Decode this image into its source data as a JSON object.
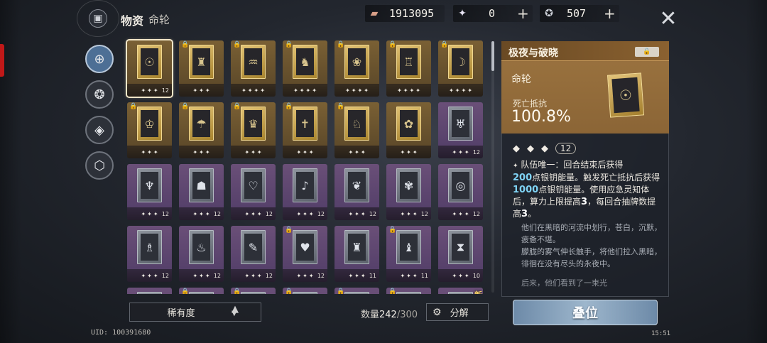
{
  "header": {
    "title": "物资",
    "subtitle": "命轮",
    "resources": [
      {
        "icon": "ticket-icon",
        "value": "1913095",
        "has_plus": false
      },
      {
        "icon": "crystal-icon",
        "value": "0",
        "has_plus": true
      },
      {
        "icon": "orb-icon",
        "value": "507",
        "has_plus": true
      }
    ]
  },
  "sidebar": {
    "items": [
      {
        "name": "compass-tab",
        "glyph": "⊕",
        "active": true
      },
      {
        "name": "prism-tab",
        "glyph": "❂",
        "active": false
      },
      {
        "name": "diamond-tab",
        "glyph": "◈",
        "active": false
      },
      {
        "name": "cube-tab",
        "glyph": "⬡",
        "active": false
      }
    ]
  },
  "grid": {
    "rows": [
      [
        {
          "rarity": "gold",
          "stars": 3,
          "level": "12",
          "locked": false,
          "selected": true,
          "art": "☉"
        },
        {
          "rarity": "gold",
          "stars": 3,
          "level": "",
          "locked": true,
          "selected": false,
          "art": "♜"
        },
        {
          "rarity": "gold",
          "stars": 4,
          "level": "",
          "locked": true,
          "selected": false,
          "art": "♒"
        },
        {
          "rarity": "gold",
          "stars": 4,
          "level": "",
          "locked": true,
          "selected": false,
          "art": "♞"
        },
        {
          "rarity": "gold",
          "stars": 4,
          "level": "",
          "locked": true,
          "selected": false,
          "art": "❀"
        },
        {
          "rarity": "gold",
          "stars": 4,
          "level": "",
          "locked": true,
          "selected": false,
          "art": "♖"
        },
        {
          "rarity": "gold",
          "stars": 4,
          "level": "",
          "locked": true,
          "selected": false,
          "art": "☽"
        }
      ],
      [
        {
          "rarity": "gold",
          "stars": 3,
          "level": "",
          "locked": true,
          "selected": false,
          "art": "♔"
        },
        {
          "rarity": "gold",
          "stars": 3,
          "level": "",
          "locked": true,
          "selected": false,
          "art": "☂"
        },
        {
          "rarity": "gold",
          "stars": 3,
          "level": "",
          "locked": true,
          "selected": false,
          "art": "♛"
        },
        {
          "rarity": "gold",
          "stars": 3,
          "level": "",
          "locked": true,
          "selected": false,
          "art": "✝"
        },
        {
          "rarity": "gold",
          "stars": 3,
          "level": "",
          "locked": true,
          "selected": false,
          "art": "♘"
        },
        {
          "rarity": "gold",
          "stars": 3,
          "level": "",
          "locked": false,
          "selected": false,
          "art": "✿"
        },
        {
          "rarity": "purple",
          "stars": 3,
          "level": "12",
          "locked": false,
          "selected": false,
          "art": "♅"
        }
      ],
      [
        {
          "rarity": "purple",
          "stars": 3,
          "level": "12",
          "locked": false,
          "selected": false,
          "art": "♆"
        },
        {
          "rarity": "purple",
          "stars": 3,
          "level": "12",
          "locked": false,
          "selected": false,
          "art": "☗"
        },
        {
          "rarity": "purple",
          "stars": 3,
          "level": "12",
          "locked": false,
          "selected": false,
          "art": "♡"
        },
        {
          "rarity": "purple",
          "stars": 3,
          "level": "12",
          "locked": false,
          "selected": false,
          "art": "♪"
        },
        {
          "rarity": "purple",
          "stars": 3,
          "level": "12",
          "locked": false,
          "selected": false,
          "art": "❦"
        },
        {
          "rarity": "purple",
          "stars": 3,
          "level": "12",
          "locked": false,
          "selected": false,
          "art": "✾"
        },
        {
          "rarity": "purple",
          "stars": 3,
          "level": "12",
          "locked": false,
          "selected": false,
          "art": "◎"
        }
      ],
      [
        {
          "rarity": "purple",
          "stars": 3,
          "level": "12",
          "locked": false,
          "selected": false,
          "art": "♗"
        },
        {
          "rarity": "purple",
          "stars": 3,
          "level": "12",
          "locked": false,
          "selected": false,
          "art": "♨"
        },
        {
          "rarity": "purple",
          "stars": 3,
          "level": "12",
          "locked": false,
          "selected": false,
          "art": "✎"
        },
        {
          "rarity": "purple",
          "stars": 3,
          "level": "12",
          "locked": true,
          "selected": false,
          "art": "♥"
        },
        {
          "rarity": "purple",
          "stars": 3,
          "level": "11",
          "locked": false,
          "selected": false,
          "art": "♜"
        },
        {
          "rarity": "purple",
          "stars": 3,
          "level": "11",
          "locked": true,
          "selected": false,
          "art": "♝"
        },
        {
          "rarity": "purple",
          "stars": 3,
          "level": "10",
          "locked": false,
          "selected": false,
          "art": "⧗"
        }
      ],
      [
        {
          "rarity": "purple",
          "stars": 3,
          "level": "",
          "locked": false,
          "selected": false,
          "art": "♘"
        },
        {
          "rarity": "purple",
          "stars": 3,
          "level": "",
          "locked": true,
          "selected": false,
          "art": "♙"
        },
        {
          "rarity": "purple",
          "stars": 3,
          "level": "",
          "locked": true,
          "selected": false,
          "art": "♟"
        },
        {
          "rarity": "purple",
          "stars": 3,
          "level": "",
          "locked": true,
          "selected": false,
          "art": "♚"
        },
        {
          "rarity": "purple",
          "stars": 3,
          "level": "",
          "locked": true,
          "selected": false,
          "art": "♛"
        },
        {
          "rarity": "purple",
          "stars": 3,
          "level": "",
          "locked": true,
          "selected": false,
          "art": "♜"
        },
        {
          "rarity": "purple",
          "stars": 3,
          "level": "",
          "locked": false,
          "selected": false,
          "art": "☀",
          "new_label": "新"
        }
      ]
    ]
  },
  "bottom": {
    "sort_label": "稀有度",
    "count_label": "数量",
    "count_current": "242",
    "count_max": "/300",
    "disassemble_label": "分解",
    "uid": "UID: 100391680",
    "clock": "15:51"
  },
  "detail": {
    "title": "极夜与破晓",
    "category": "命轮",
    "stat_name": "死亡抵抗",
    "stat_value": "100.8%",
    "level": "12",
    "effect": {
      "p1": "队伍唯一：回合结束后获得",
      "v1": "200",
      "p2": "点银钥能量。触发死亡抵抗后获得",
      "v2": "1000",
      "p3": "点银钥能量。使用应急灵知体后，算力上限提高",
      "v3": "3",
      "p4": "，每回合抽牌数提高",
      "v4": "3",
      "p5": "。"
    },
    "flavor_1": "他们在黑暗的河流中划行，苍白，沉默，疲惫不堪。",
    "flavor_2": "朦胧的雾气伸长触手，将他们拉入黑暗，徘徊在没有尽头的永夜中。",
    "flavor_3": "后来，他们看到了一束光",
    "stack_button": "叠位"
  },
  "colors": {
    "gold_card": "#7a6034",
    "purple_card": "#6a4f78",
    "highlight_blue": "#7fd3f5",
    "panel_head": "#9c7440"
  }
}
